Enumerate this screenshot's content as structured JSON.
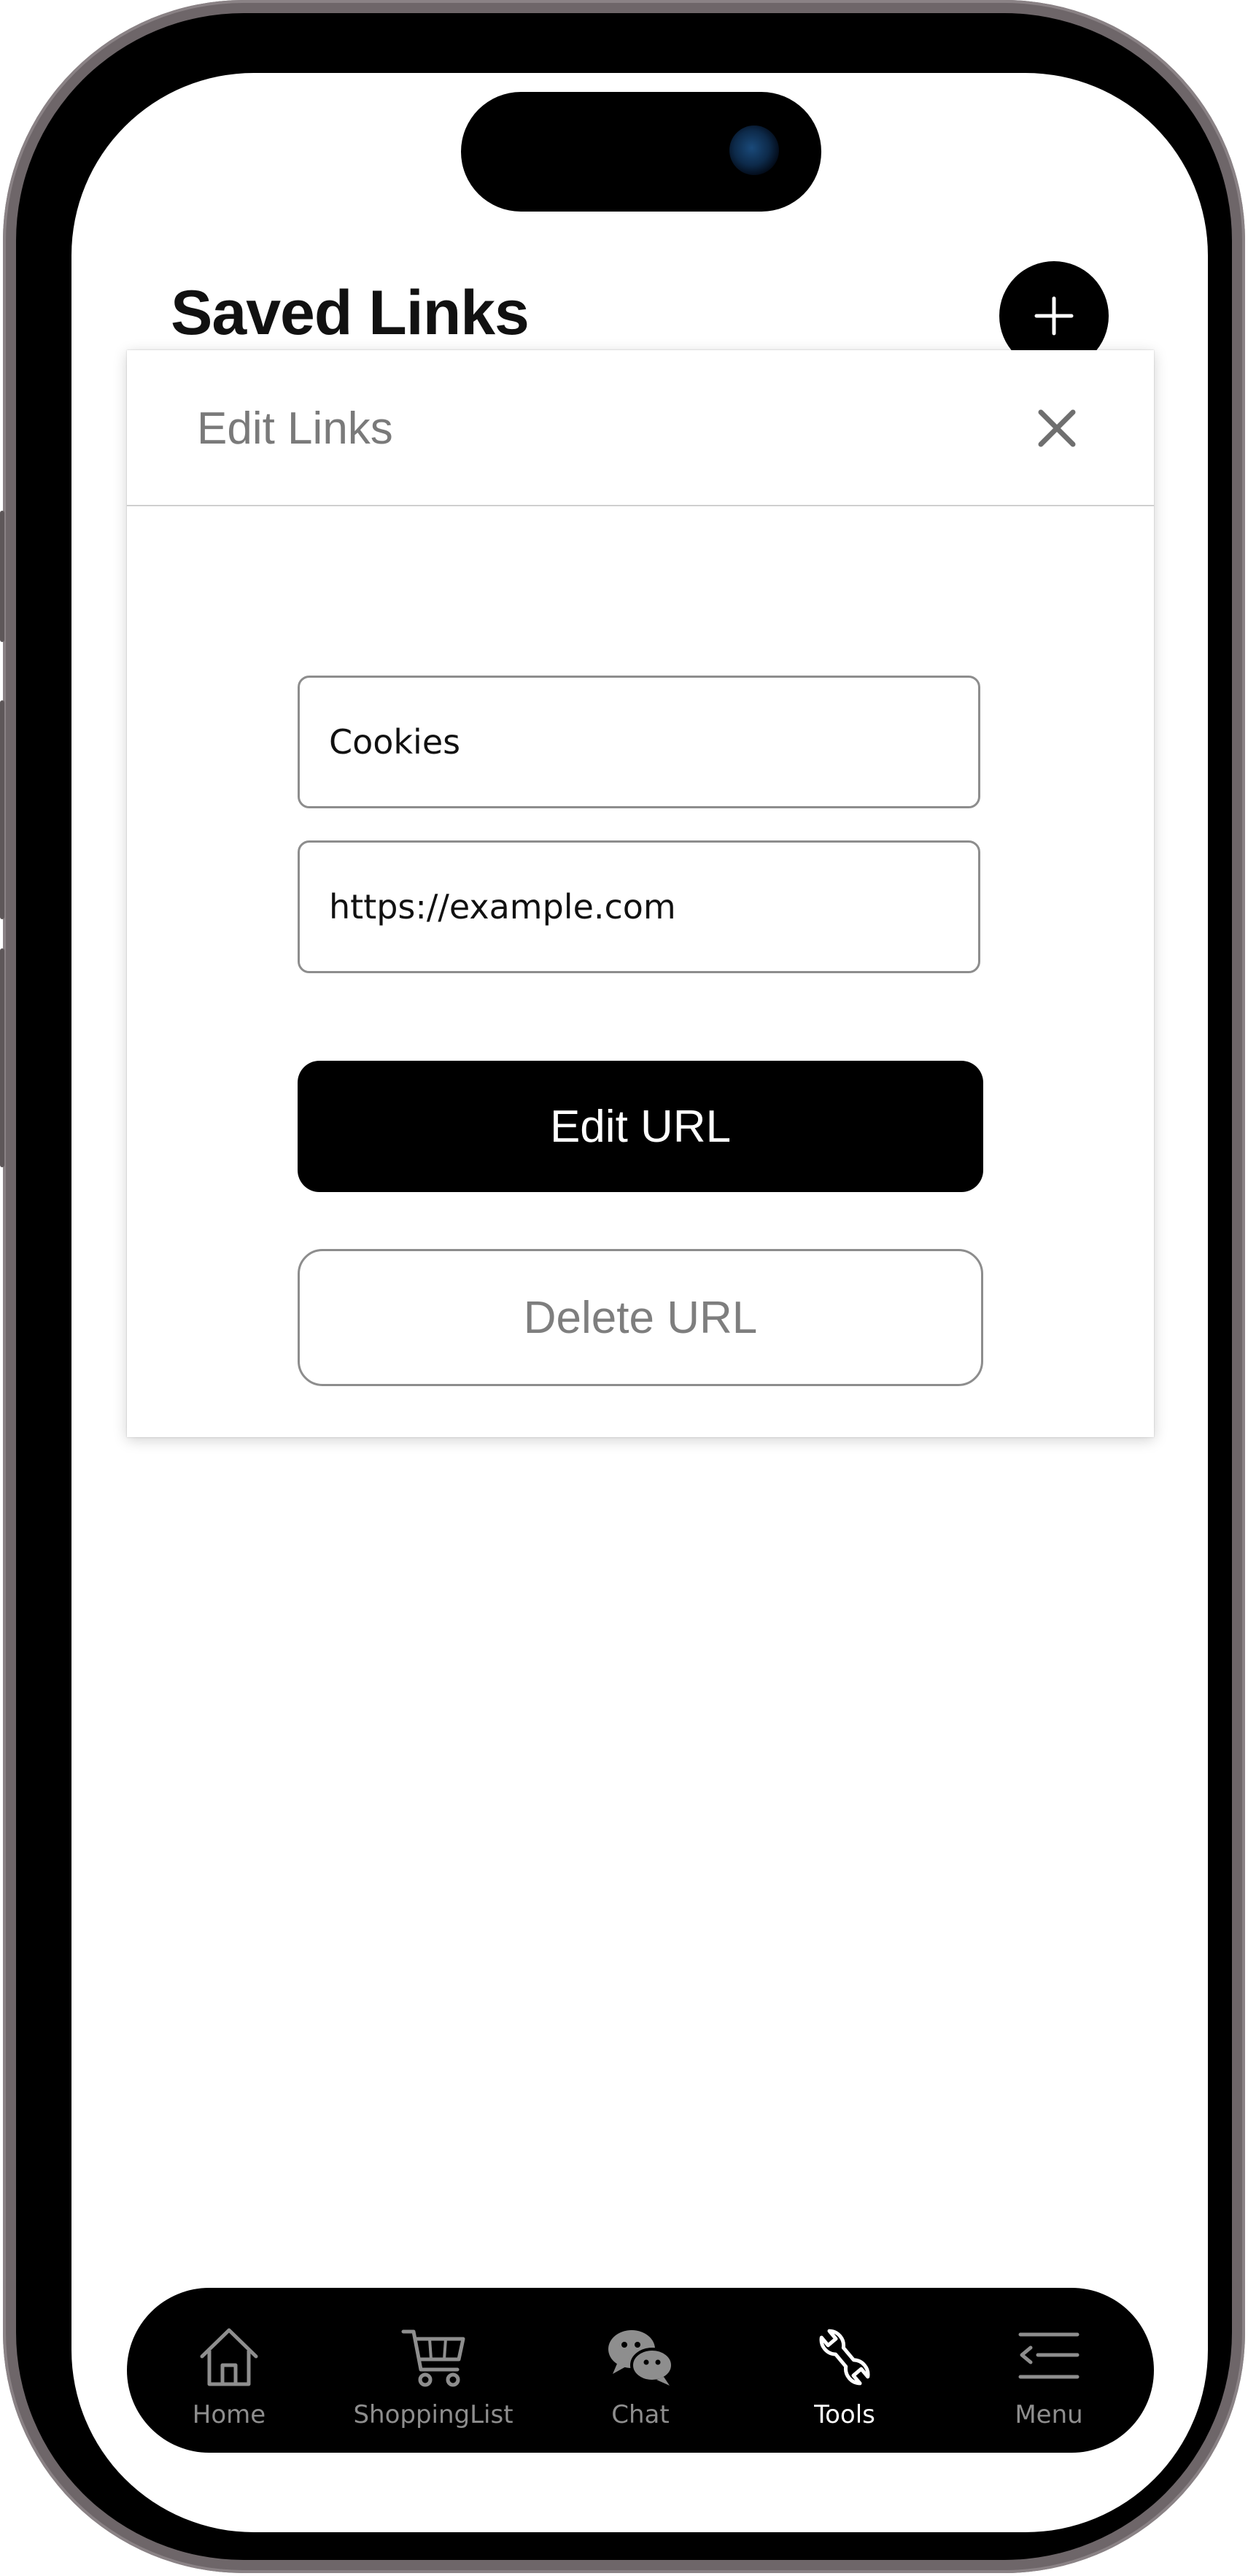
{
  "page": {
    "title": "Saved Links",
    "add_button_icon": "plus-icon"
  },
  "modal": {
    "title": "Edit Links",
    "close_icon": "close-icon",
    "name_field": {
      "value": "Cookies"
    },
    "url_field": {
      "value": "https://example.com"
    },
    "edit_button_label": "Edit URL",
    "delete_button_label": "Delete URL"
  },
  "tabbar": {
    "items": [
      {
        "label": "Home",
        "icon": "home-icon"
      },
      {
        "label": "ShoppingList",
        "icon": "shopping-cart-icon"
      },
      {
        "label": "Chat",
        "icon": "chat-icon"
      },
      {
        "label": "Tools",
        "icon": "tools-icon",
        "active": true
      },
      {
        "label": "Menu",
        "icon": "menu-icon"
      }
    ]
  },
  "colors": {
    "accent": "#000000",
    "tab_inactive": "#8e8e8e",
    "tab_active": "#ffffff",
    "muted_text": "#7a7a7a"
  }
}
